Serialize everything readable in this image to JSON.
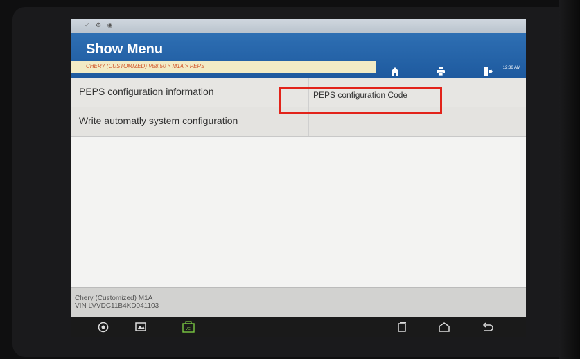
{
  "header": {
    "title": "Show Menu",
    "breadcrumb": "CHERY (CUSTOMIZED) V58.50 > M1A > PEPS",
    "buttons": [
      {
        "name": "home",
        "icon": "home-icon"
      },
      {
        "name": "print",
        "icon": "printer-icon"
      },
      {
        "name": "exit",
        "icon": "exit-icon"
      }
    ]
  },
  "status": {
    "time": "12:36 AM"
  },
  "menu": {
    "items": [
      {
        "label": "PEPS configuration information",
        "value": "PEPS configuration Code"
      },
      {
        "label": "Write automatly system configuration",
        "value": ""
      }
    ]
  },
  "footer": {
    "vehicle": "Chery (Customized) M1A",
    "vin": "VIN LVVDC11B4KD041103"
  },
  "navbar": {
    "items": [
      {
        "name": "browser",
        "icon": "browser-icon"
      },
      {
        "name": "screenshot",
        "icon": "gallery-icon"
      },
      {
        "name": "vci",
        "icon": "vci-icon",
        "label": "VCI"
      },
      {
        "name": "recent",
        "icon": "recent-apps-icon"
      },
      {
        "name": "home",
        "icon": "home-nav-icon"
      },
      {
        "name": "back",
        "icon": "back-icon"
      }
    ]
  },
  "colors": {
    "header": "#2e6fb3",
    "breadcrumb_text": "#d0562b",
    "highlight": "#e2231a",
    "vci": "#7ac943"
  }
}
